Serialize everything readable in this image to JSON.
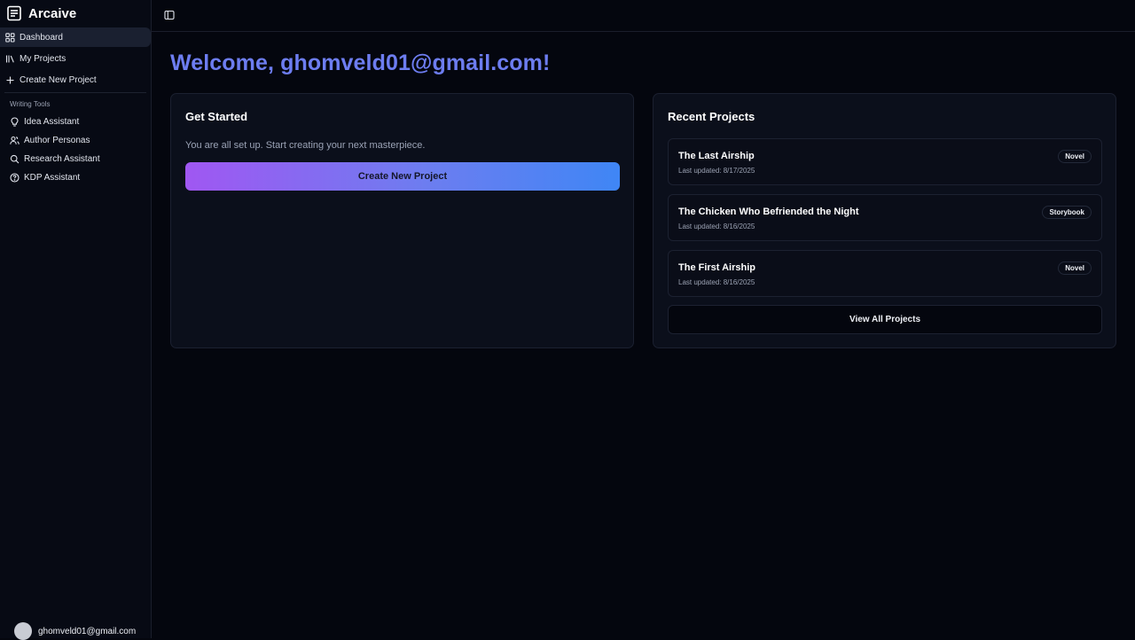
{
  "app": {
    "name": "Arcaive"
  },
  "sidebar": {
    "nav": [
      {
        "label": "Dashboard",
        "icon": "grid-icon",
        "active": true
      },
      {
        "label": "My Projects",
        "icon": "library-icon",
        "active": false
      },
      {
        "label": "Create New Project",
        "icon": "plus-icon",
        "active": false
      }
    ],
    "section_label": "Writing Tools",
    "tools": [
      {
        "label": "Idea Assistant",
        "icon": "lightbulb-icon"
      },
      {
        "label": "Author Personas",
        "icon": "users-icon"
      },
      {
        "label": "Research Assistant",
        "icon": "search-icon"
      },
      {
        "label": "KDP Assistant",
        "icon": "help-circle-icon"
      }
    ],
    "user_email": "ghomveld01@gmail.com"
  },
  "main": {
    "welcome": "Welcome, ghomveld01@gmail.com!",
    "get_started": {
      "title": "Get Started",
      "description": "You are all set up. Start creating your next masterpiece.",
      "button": "Create New Project"
    },
    "recent": {
      "title": "Recent Projects",
      "projects": [
        {
          "title": "The Last Airship",
          "updated": "Last updated: 8/17/2025",
          "type": "Novel"
        },
        {
          "title": "The Chicken Who Befriended the Night",
          "updated": "Last updated: 8/16/2025",
          "type": "Storybook"
        },
        {
          "title": "The First Airship",
          "updated": "Last updated: 8/16/2025",
          "type": "Novel"
        }
      ],
      "view_all": "View All Projects"
    }
  },
  "colors": {
    "accent": "#6d7df0",
    "gradient_start": "#a057f2",
    "gradient_end": "#3f86f5",
    "background": "#04060e"
  }
}
